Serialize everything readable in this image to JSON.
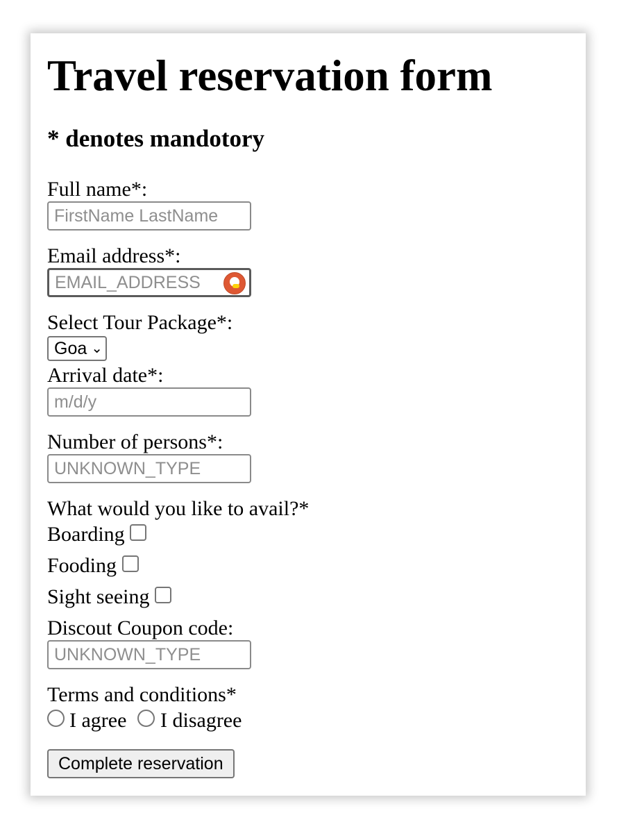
{
  "form": {
    "title": "Travel reservation form",
    "mandatory_note": "* denotes mandotory",
    "full_name": {
      "label": "Full name*:",
      "placeholder": "FirstName LastName",
      "value": ""
    },
    "email": {
      "label": "Email address*:",
      "placeholder": "EMAIL_ADDRESS",
      "value": "",
      "autofill_icon": "duckduckgo-icon"
    },
    "tour_package": {
      "label": "Select Tour Package*:",
      "selected": "Goa",
      "chevron_icon": "chevron-down-icon"
    },
    "arrival_date": {
      "label": "Arrival date*:",
      "placeholder": "m/d/y",
      "value": ""
    },
    "persons": {
      "label": "Number of persons*:",
      "placeholder": "UNKNOWN_TYPE",
      "value": ""
    },
    "avail": {
      "label": "What would you like to avail?*",
      "options": [
        {
          "label": "Boarding",
          "checked": false
        },
        {
          "label": "Fooding",
          "checked": false
        },
        {
          "label": "Sight seeing",
          "checked": false
        }
      ]
    },
    "coupon": {
      "label": "Discout Coupon code:",
      "placeholder": "UNKNOWN_TYPE",
      "value": ""
    },
    "terms": {
      "label": "Terms and conditions*",
      "agree": "I agree",
      "disagree": "I disagree"
    },
    "submit_label": "Complete reservation"
  }
}
